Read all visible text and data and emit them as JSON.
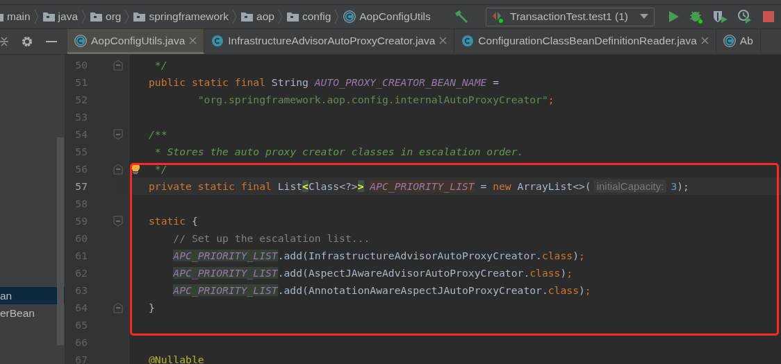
{
  "breadcrumbs": [
    {
      "label": "main",
      "kind": "folder"
    },
    {
      "label": "java",
      "kind": "folder"
    },
    {
      "label": "org",
      "kind": "folder"
    },
    {
      "label": "springframework",
      "kind": "folder"
    },
    {
      "label": "aop",
      "kind": "folder"
    },
    {
      "label": "config",
      "kind": "folder"
    },
    {
      "label": "AopConfigUtils",
      "kind": "class-file"
    }
  ],
  "run_config": {
    "label": "TransactionTest.test1 (1)"
  },
  "tabs": [
    {
      "label": "AopConfigUtils.java",
      "kind": "class-file",
      "selected": true,
      "closable": true
    },
    {
      "label": "InfrastructureAdvisorAutoProxyCreator.java",
      "kind": "class",
      "selected": false,
      "closable": true
    },
    {
      "label": "ConfigurationClassBeanDefinitionReader.java",
      "kind": "class",
      "selected": false,
      "closable": true
    },
    {
      "label": "Ab",
      "kind": "class-file",
      "selected": false,
      "closable": false
    }
  ],
  "project_tree": {
    "items": [
      {
        "label": "an",
        "selected": true
      },
      {
        "label": "erBean",
        "selected": false
      }
    ]
  },
  "editor": {
    "lines": [
      {
        "number": "50",
        "kind": "top",
        "current": false,
        "fold_marker": {
          "kind": "end"
        },
        "bulb": false,
        "tokens": [
          {
            "kind": "doc",
            "text": " */"
          }
        ]
      },
      {
        "number": "51",
        "kind": "top",
        "current": false,
        "bulb": false,
        "tokens": [
          {
            "kind": "keyword",
            "text": "public static final "
          },
          {
            "kind": "plain",
            "text": "String "
          },
          {
            "kind": "field",
            "text": "AUTO_PROXY_CREATOR_BEAN_NAME"
          },
          {
            "kind": "plain",
            "text": " ="
          }
        ]
      },
      {
        "number": "52",
        "kind": "continuation",
        "current": false,
        "bulb": false,
        "tokens": [
          {
            "kind": "string",
            "text": "\"org.springframework.aop.config.internalAutoProxyCreator\""
          },
          {
            "kind": "keyword",
            "text": ";"
          }
        ]
      },
      {
        "number": "53",
        "current": false,
        "bulb": false
      },
      {
        "number": "54",
        "kind": "top",
        "current": false,
        "fold_marker": {
          "kind": "start"
        },
        "bulb": false,
        "tokens": [
          {
            "kind": "doc",
            "text": "/**"
          }
        ]
      },
      {
        "number": "55",
        "kind": "top",
        "current": false,
        "bulb": false,
        "tokens": [
          {
            "kind": "doc",
            "text": " * Stores the auto proxy creator classes in escalation order."
          }
        ]
      },
      {
        "number": "56",
        "kind": "top",
        "current": false,
        "fold_marker": {
          "kind": "end"
        },
        "bulb": true,
        "tokens": [
          {
            "kind": "doc",
            "text": " */"
          }
        ]
      },
      {
        "number": "57",
        "kind": "top",
        "current": true,
        "bulb": false,
        "tokens": [
          {
            "kind": "keyword",
            "text": "private static final "
          },
          {
            "kind": "plain",
            "text": "List"
          },
          {
            "kind": "brace-match",
            "text": "<"
          },
          {
            "kind": "plain",
            "text": "Class<?>"
          },
          {
            "kind": "brace-match",
            "text": ">"
          },
          {
            "kind": "field-write",
            "text": "APC_PRIORITY_LIST"
          },
          {
            "kind": "operator",
            "text": "="
          },
          {
            "kind": "keyword",
            "text": "new "
          },
          {
            "kind": "plain",
            "text": "ArrayList<>("
          },
          {
            "kind": "hint",
            "text": "initialCapacity:"
          },
          {
            "kind": "number",
            "text": "3"
          },
          {
            "kind": "plain",
            "text": ");"
          }
        ]
      },
      {
        "number": "58",
        "current": false,
        "bulb": false
      },
      {
        "number": "59",
        "kind": "top",
        "current": false,
        "fold_marker": {
          "kind": "start"
        },
        "bulb": false,
        "tokens": [
          {
            "kind": "keyword",
            "text": "static "
          },
          {
            "kind": "plain",
            "text": "{"
          }
        ]
      },
      {
        "number": "60",
        "kind": "nested",
        "current": false,
        "bulb": false,
        "tokens": [
          {
            "kind": "comment",
            "text": "// Set up the escalation list..."
          }
        ]
      },
      {
        "number": "61",
        "kind": "nested",
        "current": false,
        "bulb": false,
        "tokens": [
          {
            "kind": "field-read",
            "text": "APC_PRIORITY_LIST"
          },
          {
            "kind": "plain",
            "text": ".add(InfrastructureAdvisorAutoProxyCreator."
          },
          {
            "kind": "keyword",
            "text": "class"
          },
          {
            "kind": "plain",
            "text": ")"
          },
          {
            "kind": "keyword",
            "text": ";"
          }
        ]
      },
      {
        "number": "62",
        "kind": "nested",
        "current": false,
        "bulb": false,
        "tokens": [
          {
            "kind": "field-read",
            "text": "APC_PRIORITY_LIST"
          },
          {
            "kind": "plain",
            "text": ".add(AspectJAwareAdvisorAutoProxyCreator."
          },
          {
            "kind": "keyword",
            "text": "class"
          },
          {
            "kind": "plain",
            "text": ")"
          },
          {
            "kind": "keyword",
            "text": ";"
          }
        ]
      },
      {
        "number": "63",
        "kind": "nested",
        "current": false,
        "bulb": false,
        "tokens": [
          {
            "kind": "field-read",
            "text": "APC_PRIORITY_LIST"
          },
          {
            "kind": "plain",
            "text": ".add(AnnotationAwareAspectJAutoProxyCreator."
          },
          {
            "kind": "keyword",
            "text": "class"
          },
          {
            "kind": "plain",
            "text": ")"
          },
          {
            "kind": "keyword",
            "text": ";"
          }
        ]
      },
      {
        "number": "64",
        "kind": "top",
        "current": false,
        "fold_marker": {
          "kind": "end"
        },
        "bulb": false,
        "tokens": [
          {
            "kind": "plain",
            "text": "}"
          }
        ]
      },
      {
        "number": "65",
        "current": false,
        "bulb": false
      },
      {
        "number": "66",
        "current": false,
        "bulb": false
      },
      {
        "number": "67",
        "kind": "top",
        "current": false,
        "bulb": false,
        "tokens": [
          {
            "kind": "annotation",
            "text": "@Nullable"
          }
        ]
      }
    ]
  }
}
